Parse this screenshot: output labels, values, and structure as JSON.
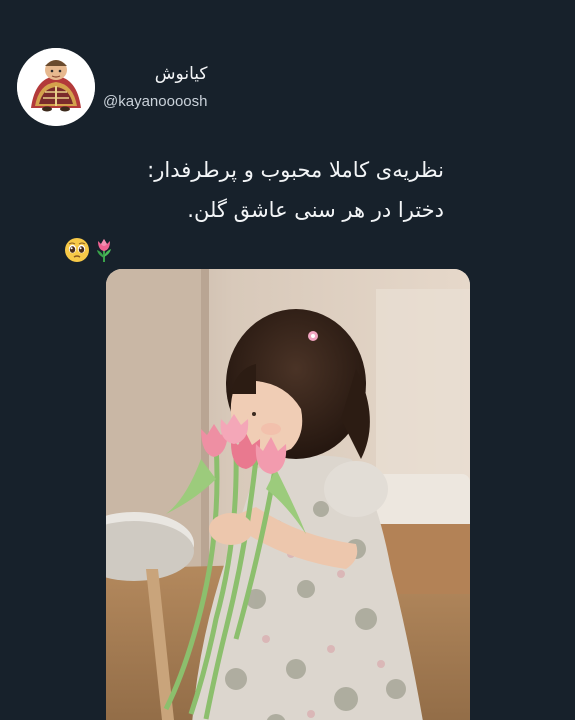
{
  "profile": {
    "display_name": "کیانوش",
    "handle": "@kayanoooosh",
    "avatar_icon": "cartoon-character-avatar-icon"
  },
  "tweet": {
    "lines": [
      "نظریه‌ی کاملا محبوب و پرطرفدار:",
      "دخترا در هر سنی عاشق گلن."
    ],
    "emojis": [
      "pleading-face-icon",
      "tulip-icon"
    ]
  },
  "media": {
    "icon": "girl-smelling-tulips-photo"
  },
  "colors": {
    "background": "#17212b",
    "text": "#f3f5f7",
    "handle": "#c9d1d9"
  }
}
